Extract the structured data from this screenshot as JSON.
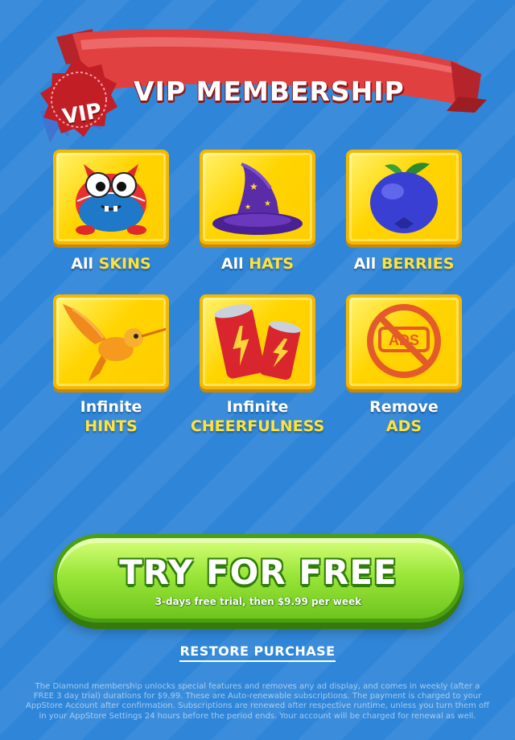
{
  "header": {
    "title": "VIP MEMBERSHIP",
    "badge_text": "VIP"
  },
  "features": [
    {
      "line1": "All",
      "highlight": "SKINS",
      "icon": "monster-icon"
    },
    {
      "line1": "All",
      "highlight": "HATS",
      "icon": "wizard-hat-icon"
    },
    {
      "line1": "All",
      "highlight": "BERRIES",
      "icon": "blueberry-icon"
    },
    {
      "line1": "Infinite",
      "highlight": "HINTS",
      "icon": "hummingbird-icon"
    },
    {
      "line1": "Infinite",
      "highlight": "CHEERFULNESS",
      "icon": "energy-can-icon"
    },
    {
      "line1": "Remove",
      "highlight": "ADS",
      "icon": "no-ads-icon",
      "icon_text": "ADS"
    }
  ],
  "cta": {
    "title": "TRY FOR FREE",
    "subtitle": "3-days free trial, then $9.99 per week"
  },
  "restore_label": "RESTORE PURCHASE",
  "legal_text": "The Diamond membership unlocks special features and removes any ad display, and comes in weekly (after a FREE 3 day trial) durations for  $9.99. These are Auto-renewable subscriptions. The payment is charged to your AppStore Account after confirmation. Subscriptions are renewed after respective runtime, unless you turn them off in your AppStore Settings 24 hours before the period ends. Your account will be charged for renewal as well.",
  "colors": {
    "background": "#2f86d9",
    "banner": "#d93a3a",
    "highlight": "#ffe23a",
    "tile": "#ffd400",
    "cta": "#8fdc32"
  }
}
